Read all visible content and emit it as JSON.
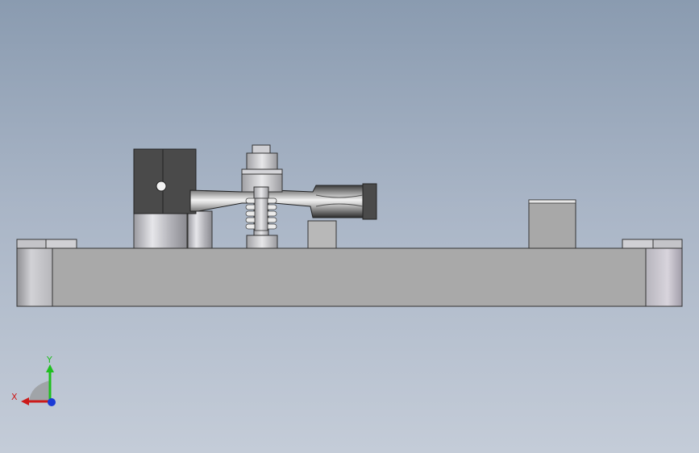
{
  "viewport": {
    "background_top": "#8a9bb0",
    "background_bottom": "#c4ccd8",
    "model_colors": {
      "plate": "#a9a9a9",
      "clamp_block": "#4a4a4a",
      "steel": "#c8c8c8",
      "spring": "#e8e8e8"
    }
  },
  "triad": {
    "x_label": "X",
    "y_label": "Y",
    "x_color": "#cc1a1a",
    "y_color": "#1fbf1f",
    "z_color": "#1a3ad6"
  }
}
